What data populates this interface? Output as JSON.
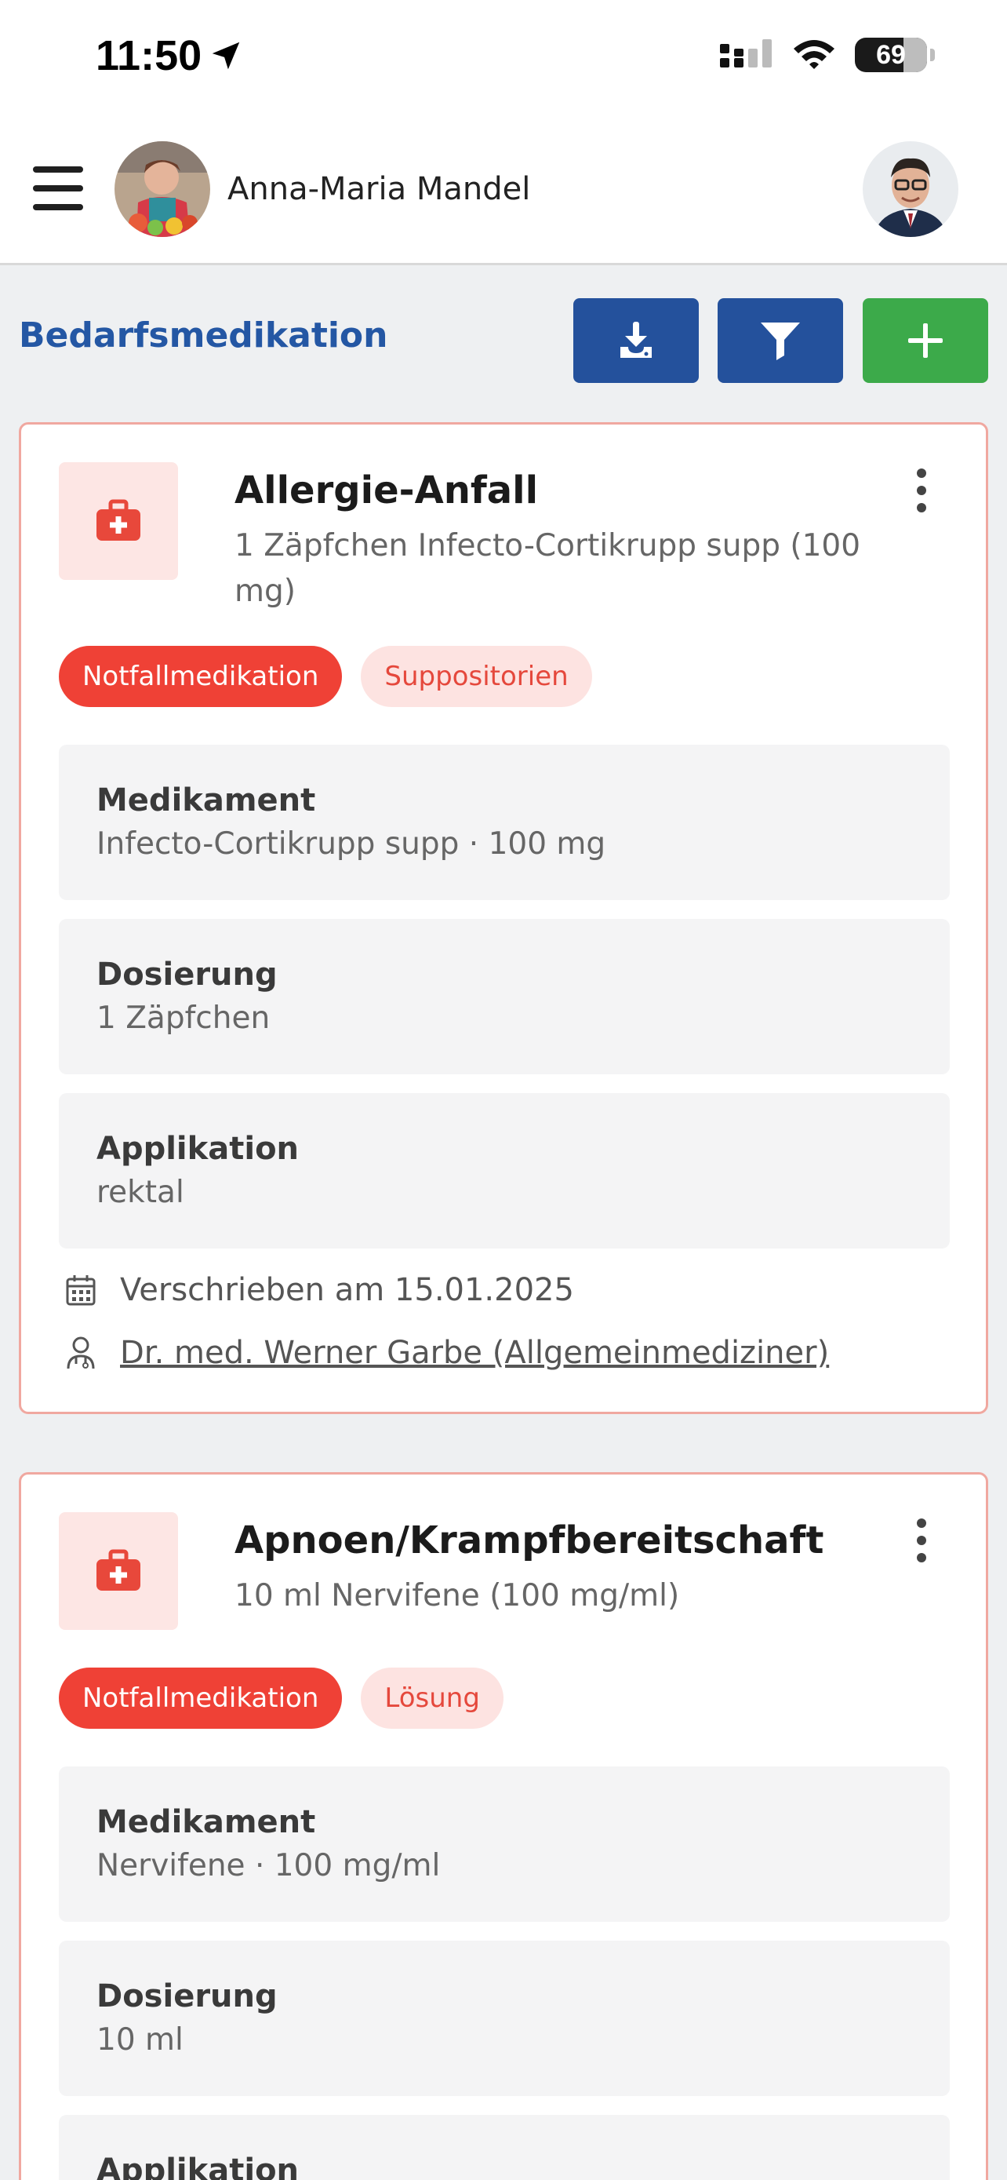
{
  "status": {
    "time": "11:50",
    "battery": "69"
  },
  "header": {
    "patient_name": "Anna-Maria Mandel"
  },
  "page": {
    "title": "Bedarfsmedikation"
  },
  "toolbar": {
    "download_icon": "download-icon",
    "filter_icon": "filter-icon",
    "add_icon": "plus-icon"
  },
  "cards": [
    {
      "title": "Allergie-Anfall",
      "subtitle": "1 Zäpfchen Infecto-Cortikrupp supp (100 mg)",
      "tags": [
        "Notfallmedikation",
        "Suppositorien"
      ],
      "fields": [
        {
          "label": "Medikament",
          "value": "Infecto-Cortikrupp supp · 100 mg"
        },
        {
          "label": "Dosierung",
          "value": "1 Zäpfchen"
        },
        {
          "label": "Applikation",
          "value": "rektal"
        }
      ],
      "prescribed": "Verschrieben am 15.01.2025",
      "doctor": "Dr. med. Werner Garbe (Allgemeinmediziner)"
    },
    {
      "title": "Apnoen/Krampfbereitschaft",
      "subtitle": "10 ml Nervifene (100 mg/ml)",
      "tags": [
        "Notfallmedikation",
        "Lösung"
      ],
      "fields": [
        {
          "label": "Medikament",
          "value": "Nervifene · 100 mg/ml"
        },
        {
          "label": "Dosierung",
          "value": "10 ml"
        },
        {
          "label": "Applikation",
          "value": ""
        }
      ]
    }
  ],
  "colors": {
    "accent_blue": "#24519c",
    "accent_green": "#3caa4a",
    "emergency_red": "#ef4136",
    "card_border": "#f0a8a0"
  }
}
